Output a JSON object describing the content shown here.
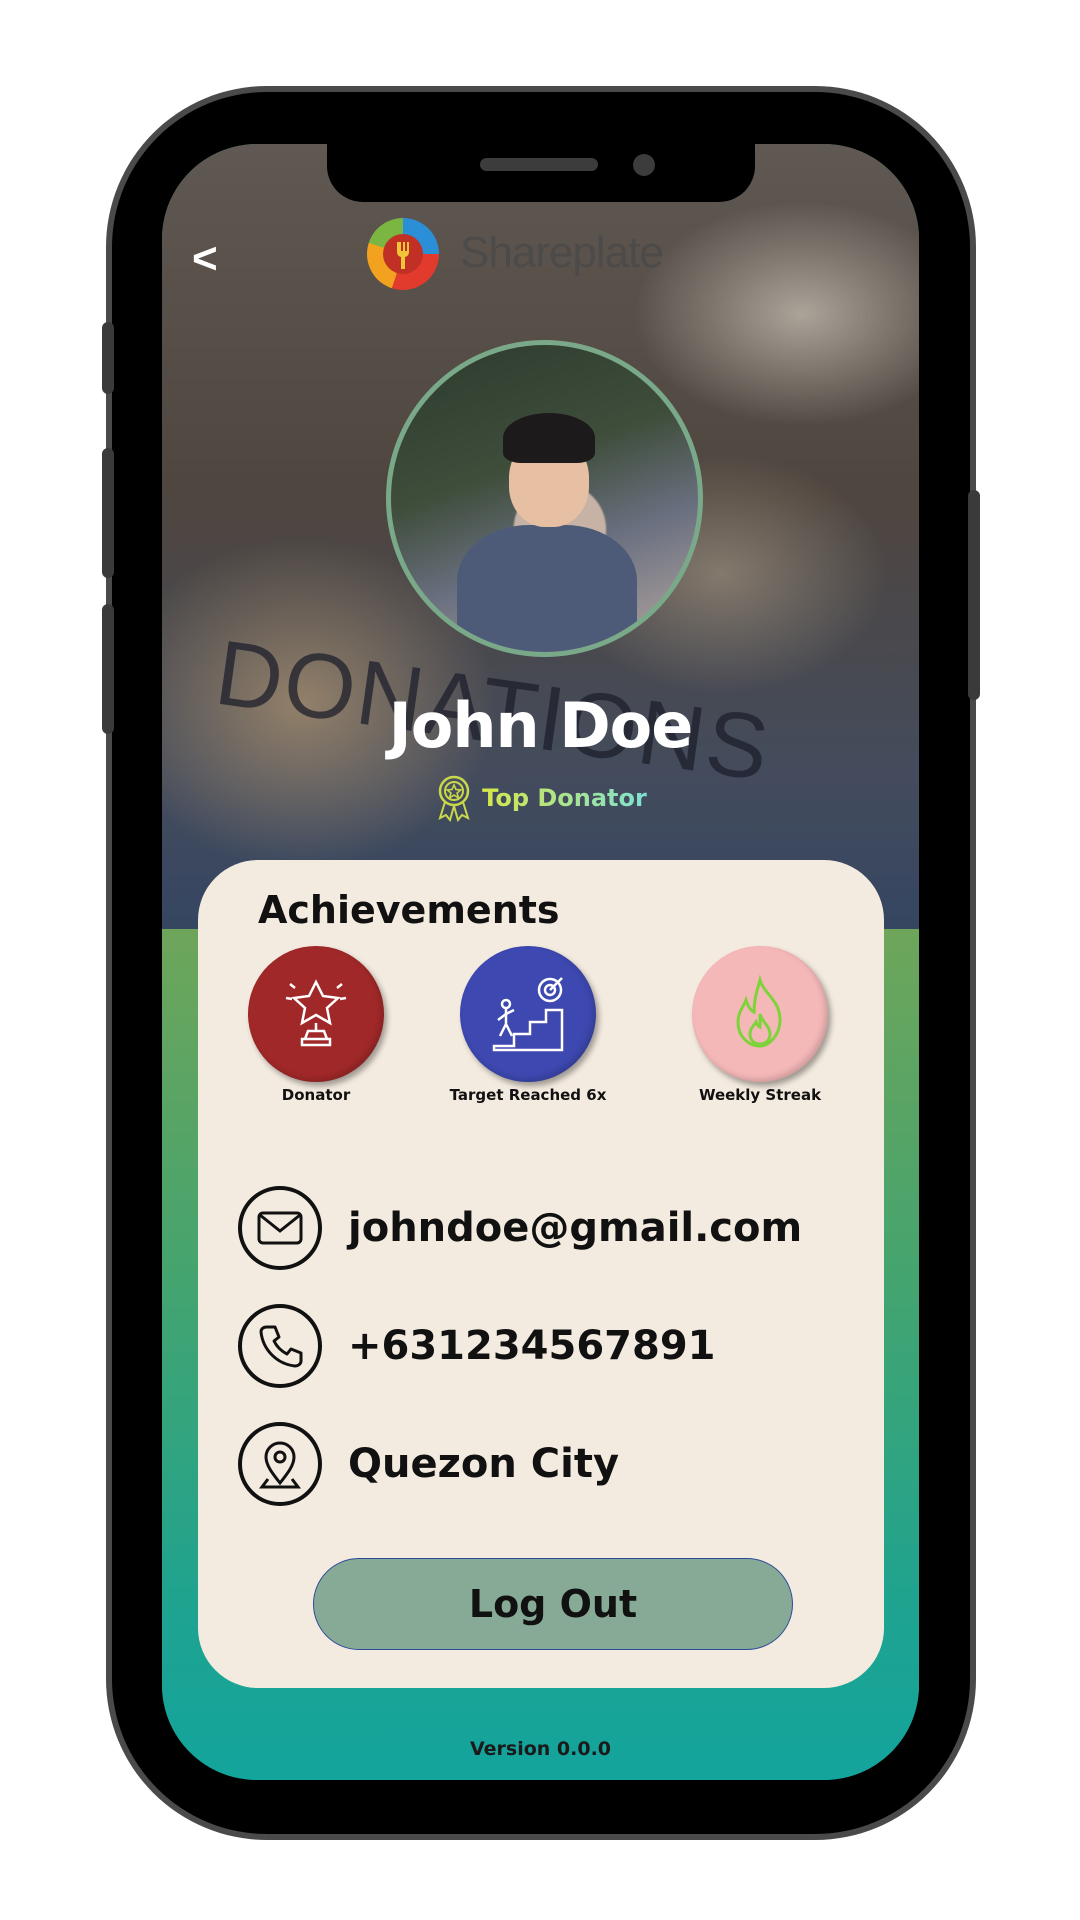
{
  "header": {
    "back_label": "<",
    "brand_name": "Shareplate"
  },
  "background": {
    "photo_text": "DONATIONS"
  },
  "profile": {
    "name": "John Doe",
    "rank_label": "Top Donator"
  },
  "achievements": {
    "title": "Achievements",
    "items": [
      {
        "label": "Donator",
        "icon": "trophy-star-icon",
        "color": "#a02828"
      },
      {
        "label": "Target Reached 6x",
        "icon": "climb-target-icon",
        "color": "#3d48b0"
      },
      {
        "label": "Weekly Streak",
        "icon": "flame-icon",
        "color": "#f5b8b8"
      }
    ]
  },
  "contact": {
    "email": "johndoe@gmail.com",
    "phone": "+631234567891",
    "location": "Quezon City"
  },
  "actions": {
    "logout_label": "Log Out"
  },
  "footer": {
    "version": "Version 0.0.0"
  }
}
